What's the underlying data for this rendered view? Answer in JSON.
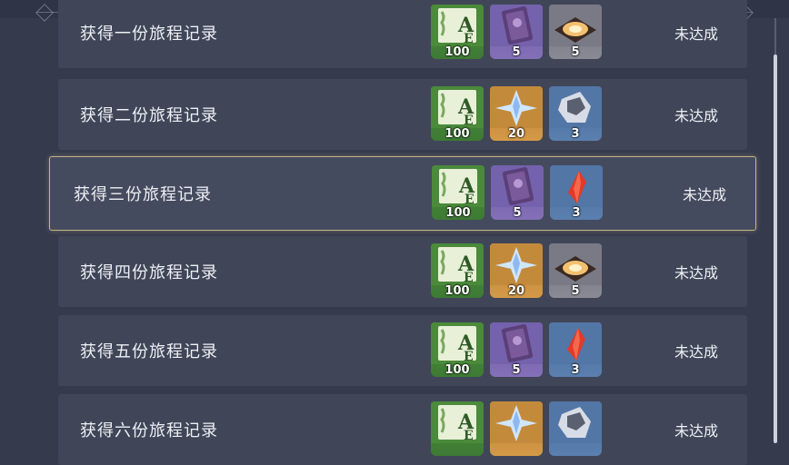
{
  "rows": [
    {
      "title": "获得一份旅程记录",
      "status": "未达成",
      "rewards": [
        {
          "icon": "adventure-exp-icon",
          "count": "100",
          "bg": "green"
        },
        {
          "icon": "heros-wit-book-icon",
          "count": "5",
          "bg": "purple"
        },
        {
          "icon": "mystic-enhancement-ore-icon",
          "count": "5",
          "bg": "gray"
        }
      ]
    },
    {
      "title": "获得二份旅程记录",
      "status": "未达成",
      "rewards": [
        {
          "icon": "adventure-exp-icon",
          "count": "100",
          "bg": "green"
        },
        {
          "icon": "primogem-icon",
          "count": "20",
          "bg": "orange"
        },
        {
          "icon": "weapon-ore-icon",
          "count": "3",
          "bg": "blue"
        }
      ]
    },
    {
      "title": "获得三份旅程记录",
      "status": "未达成",
      "rewards": [
        {
          "icon": "adventure-exp-icon",
          "count": "100",
          "bg": "green"
        },
        {
          "icon": "heros-wit-book-icon",
          "count": "5",
          "bg": "purple"
        },
        {
          "icon": "red-crystal-icon",
          "count": "3",
          "bg": "blue"
        }
      ]
    },
    {
      "title": "获得四份旅程记录",
      "status": "未达成",
      "rewards": [
        {
          "icon": "adventure-exp-icon",
          "count": "100",
          "bg": "green"
        },
        {
          "icon": "primogem-icon",
          "count": "20",
          "bg": "orange"
        },
        {
          "icon": "mystic-enhancement-ore-icon",
          "count": "5",
          "bg": "gray"
        }
      ]
    },
    {
      "title": "获得五份旅程记录",
      "status": "未达成",
      "rewards": [
        {
          "icon": "adventure-exp-icon",
          "count": "100",
          "bg": "green"
        },
        {
          "icon": "heros-wit-book-icon",
          "count": "5",
          "bg": "purple"
        },
        {
          "icon": "red-crystal-icon",
          "count": "3",
          "bg": "blue"
        }
      ]
    },
    {
      "title": "获得六份旅程记录",
      "status": "未达成",
      "rewards": [
        {
          "icon": "adventure-exp-icon",
          "count": "",
          "bg": "green"
        },
        {
          "icon": "primogem-icon",
          "count": "",
          "bg": "orange"
        },
        {
          "icon": "weapon-ore-icon",
          "count": "",
          "bg": "blue"
        }
      ]
    }
  ],
  "selected_index": 2,
  "colors": {
    "row_bg": "#404658",
    "selected_border": "#c4b48a",
    "page_bg": "#353a4d"
  }
}
